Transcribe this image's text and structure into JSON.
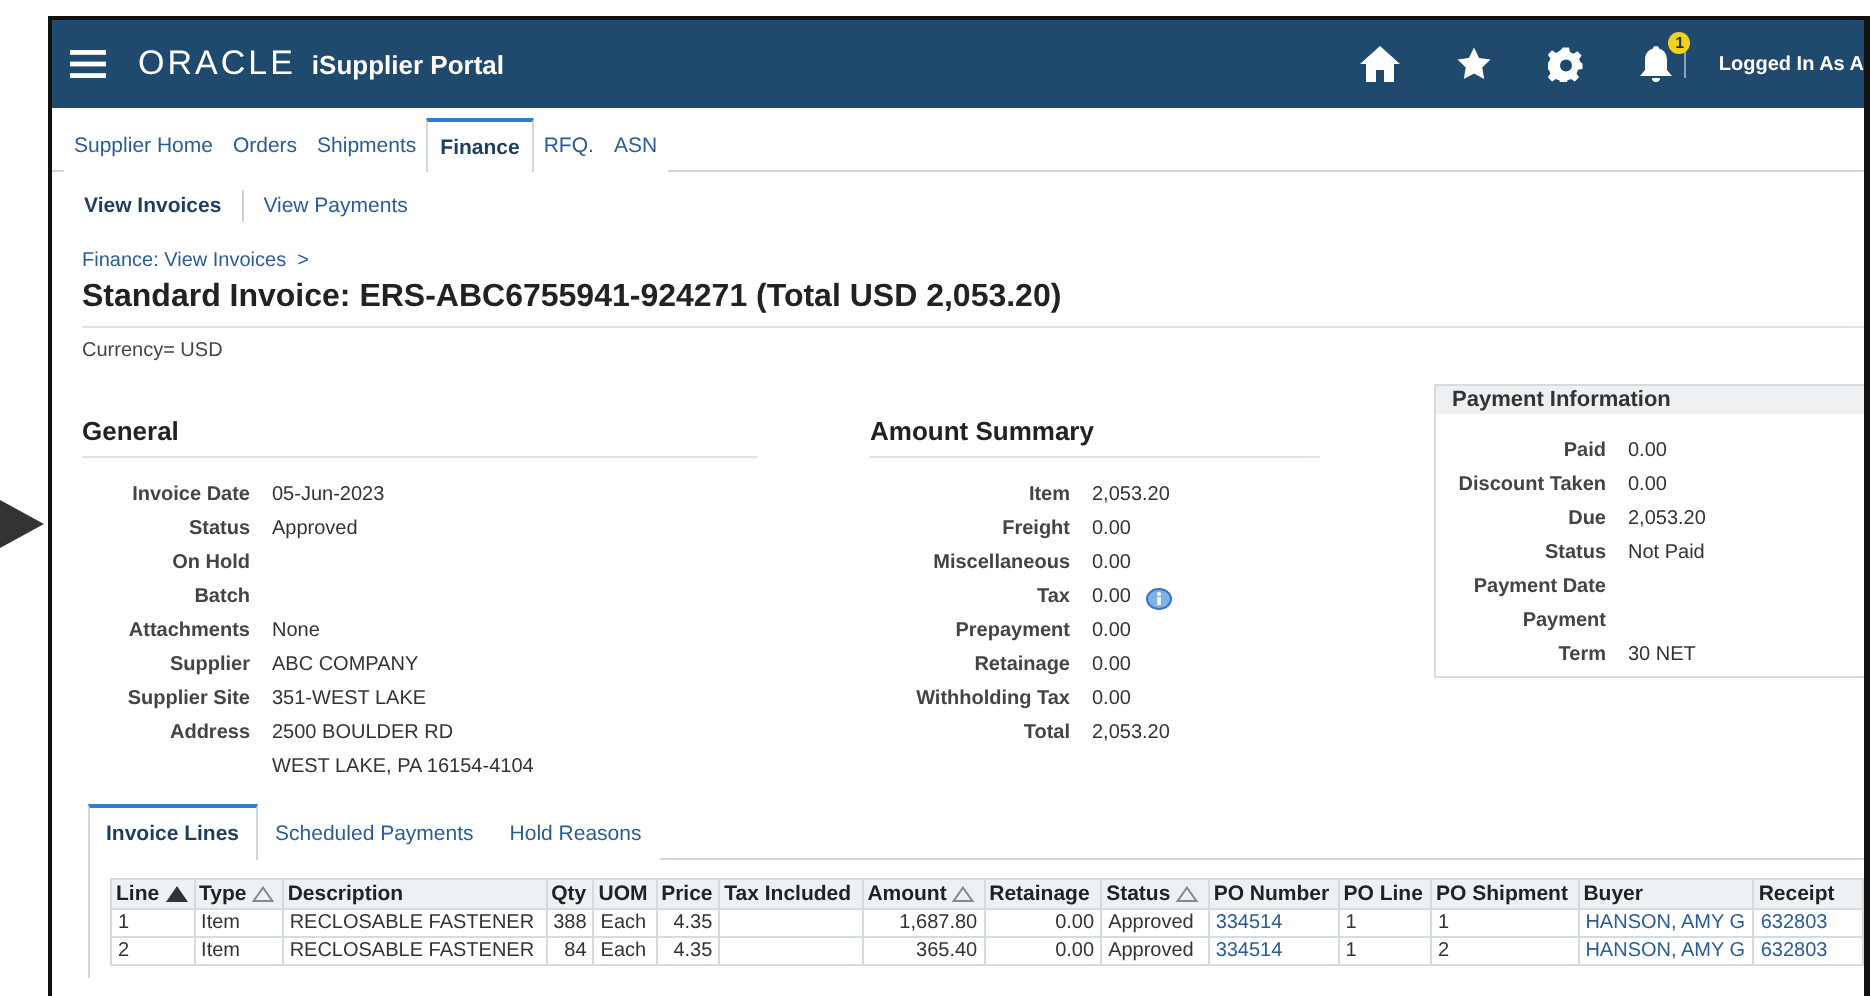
{
  "header": {
    "logo": "ORACLE",
    "product": "iSupplier Portal",
    "notification_count": "1",
    "user": "Logged In As A"
  },
  "tabs": [
    {
      "label": "Supplier Home",
      "selected": false
    },
    {
      "label": "Orders",
      "selected": false
    },
    {
      "label": "Shipments",
      "selected": false
    },
    {
      "label": "Finance",
      "selected": true
    },
    {
      "label": "RFQ.",
      "selected": false
    },
    {
      "label": "ASN",
      "selected": false
    }
  ],
  "subtabs": [
    {
      "label": "View Invoices",
      "selected": true
    },
    {
      "label": "View Payments",
      "selected": false
    }
  ],
  "breadcrumb": "Finance: View Invoices  >",
  "title": "Standard Invoice: ERS-ABC6755941-924271 (Total USD 2,053.20)",
  "currency": "Currency= USD",
  "general": {
    "heading": "General",
    "fields": [
      {
        "label": "Invoice Date",
        "value": "05-Jun-2023"
      },
      {
        "label": "Status",
        "value": "Approved"
      },
      {
        "label": "On Hold"
      },
      {
        "label": "Batch"
      },
      {
        "label": "Attachments",
        "value": "None"
      },
      {
        "label": "Supplier",
        "value": "ABC COMPANY"
      },
      {
        "label": "Supplier Site",
        "value": "351-WEST LAKE"
      },
      {
        "label": "Address",
        "value": "2500 BOULDER RD"
      },
      {
        "value": "WEST LAKE, PA 16154-4104"
      }
    ]
  },
  "amount_summary": {
    "heading": "Amount Summary",
    "fields": [
      {
        "label": "Item",
        "value": "2,053.20"
      },
      {
        "label": "Freight",
        "value": "0.00"
      },
      {
        "label": "Miscellaneous",
        "value": "0.00"
      },
      {
        "label": "Tax",
        "value": "0.00",
        "info": true
      },
      {
        "label": "Prepayment",
        "value": "0.00"
      },
      {
        "label": "Retainage",
        "value": "0.00"
      },
      {
        "label": "Withholding Tax",
        "value": "0.00"
      },
      {
        "label": "Total",
        "value": "2,053.20"
      }
    ]
  },
  "payment_information": {
    "heading": "Payment Information",
    "fields": [
      {
        "label": "Paid",
        "value": "0.00"
      },
      {
        "label": "Discount Taken",
        "value": "0.00"
      },
      {
        "label": "Due",
        "value": "2,053.20"
      },
      {
        "label": "Status",
        "value": "Not Paid"
      },
      {
        "label": "Payment Date"
      },
      {
        "label": "Payment"
      },
      {
        "label": "Term",
        "value": "30 NET"
      }
    ]
  },
  "detail_tabs": [
    {
      "label": "Invoice Lines",
      "selected": true
    },
    {
      "label": "Scheduled Payments",
      "selected": false
    },
    {
      "label": "Hold Reasons",
      "selected": false
    }
  ],
  "table": {
    "columns": [
      {
        "label": "Line",
        "sorted": true,
        "kind": "text"
      },
      {
        "label": "Type",
        "sorted": false,
        "kind": "text"
      },
      {
        "label": "Description",
        "kind": "text"
      },
      {
        "label": "Qty",
        "kind": "number"
      },
      {
        "label": "UOM",
        "kind": "text"
      },
      {
        "label": "Price",
        "kind": "number"
      },
      {
        "label": "Tax Included",
        "kind": "text"
      },
      {
        "label": "Amount",
        "sorted": false,
        "kind": "number"
      },
      {
        "label": "Retainage",
        "kind": "number"
      },
      {
        "label": "Status",
        "sorted": false,
        "kind": "text"
      },
      {
        "label": "PO Number",
        "kind": "link"
      },
      {
        "label": "PO Line",
        "kind": "text"
      },
      {
        "label": "PO Shipment",
        "kind": "text"
      },
      {
        "label": "Buyer",
        "kind": "link"
      },
      {
        "label": "Receipt",
        "kind": "link"
      }
    ],
    "rows": [
      [
        "1",
        "Item",
        "RECLOSABLE FASTENER",
        "388",
        "Each",
        "4.35",
        "",
        "1,687.80",
        "0.00",
        "Approved",
        "334514",
        "1",
        "1",
        "HANSON, AMY G",
        "632803"
      ],
      [
        "2",
        "Item",
        "RECLOSABLE FASTENER",
        "84",
        "Each",
        "4.35",
        "",
        "365.40",
        "0.00",
        "Approved",
        "334514",
        "1",
        "2",
        "HANSON, AMY G",
        "632803"
      ]
    ]
  }
}
